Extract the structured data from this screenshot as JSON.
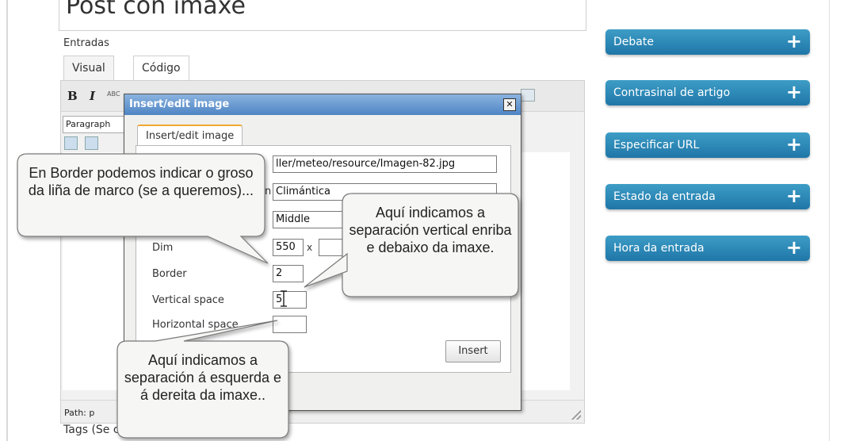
{
  "post": {
    "title": "Post con imaxe",
    "section_label": "Entradas",
    "tabs": [
      "Visual",
      "Código"
    ]
  },
  "editor": {
    "format_select": "Paragraph",
    "path_label": "Path: p",
    "toolbar_abc": "ABC"
  },
  "tags_line": "Tags (Se                              comas: tempo, clima)",
  "dialog": {
    "title": "Insert/edit image",
    "close_glyph": "✕",
    "tab_label": "Insert/edit image",
    "image_url_value": "ller/meteo/resource/Imagen-82.jpg",
    "description_label_fragment": "n",
    "description_value": "Climántica",
    "alignment_value": "Middle",
    "dimensions_label_fragment": "Dim",
    "width_value": "550",
    "dimensions_separator": "x",
    "height_value": "",
    "border_label": "Border",
    "border_value": "2",
    "vertical_space_label": "Vertical space",
    "vertical_space_value": "5",
    "horizontal_space_label": "Horizontal space",
    "horizontal_space_value": "",
    "insert_button": "Insert"
  },
  "sidebar": {
    "boxes": [
      {
        "label": "Debate",
        "icon": "plus-icon"
      },
      {
        "label": "Contrasinal de artigo",
        "icon": "plus-icon"
      },
      {
        "label": "Especificar URL",
        "icon": "plus-icon"
      },
      {
        "label": "Estado da entrada",
        "icon": "plus-icon"
      },
      {
        "label": "Hora da entrada",
        "icon": "plus-icon"
      }
    ]
  },
  "callouts": {
    "border": "En Border podemos indicar o groso da liña de marco (se a queremos)...",
    "vertical": "Aquí indicamos a separación vertical enriba e debaixo da imaxe.",
    "horizontal": "Aquí indicamos a separación á esquerda e á dereita da imaxe.."
  },
  "colors": {
    "sidebar_box": "#2a86b8",
    "dialog_title": "#5a8dcb",
    "tab_accent": "#f0a830",
    "callout_fill": "#f6f6f4"
  }
}
